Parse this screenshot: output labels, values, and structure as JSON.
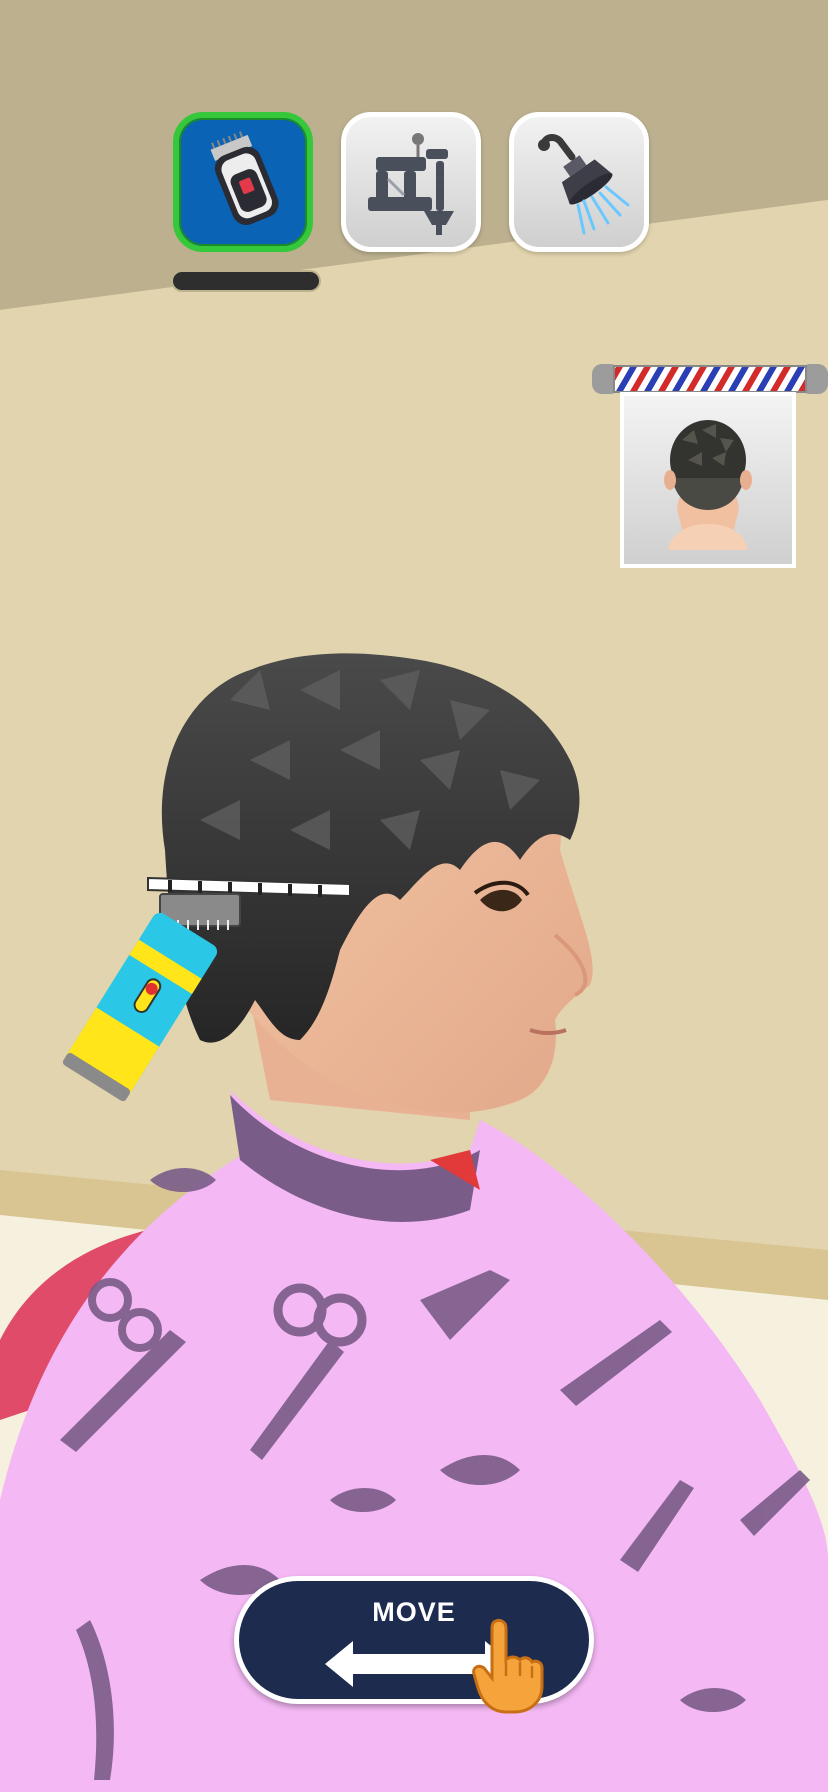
{
  "game": {
    "genre": "barber-simulator"
  },
  "toolbar": {
    "tools": [
      {
        "icon": "hair-clipper-icon",
        "selected": true
      },
      {
        "icon": "tattoo-machine-icon",
        "selected": false
      },
      {
        "icon": "shower-head-icon",
        "selected": false
      }
    ]
  },
  "reference": {
    "icon": "target-haircut-icon",
    "pole": "barber-pole-icon"
  },
  "controls": {
    "move_label": "MOVE",
    "arrow_icon": "left-right-arrow-icon",
    "hint_icon": "pointing-hand-icon"
  },
  "colors": {
    "selected_border": "#34c83a",
    "selected_fill": "#0b63b6",
    "move_button": "#1c2b4e",
    "cape": "#f4b8f4",
    "cape_pattern": "#7a5c88",
    "wall": "#e2d4ae"
  }
}
